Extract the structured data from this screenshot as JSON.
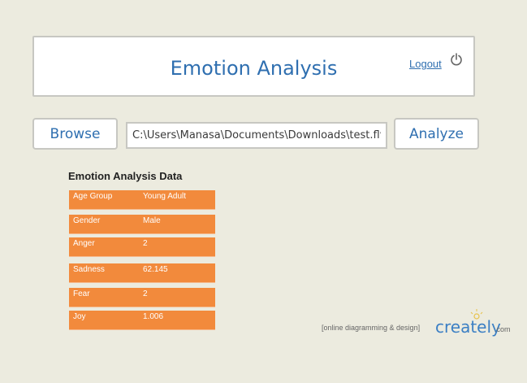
{
  "header": {
    "title": "Emotion Analysis",
    "logout_label": "Logout",
    "power_icon": "power-icon"
  },
  "toolbar": {
    "browse_label": "Browse",
    "file_path": "C:\\Users\\Manasa\\Documents\\Downloads\\test.flv",
    "analyze_label": "Analyze"
  },
  "results": {
    "title": "Emotion Analysis Data",
    "rows": [
      {
        "key": "Age Group",
        "value": "Young Adult"
      },
      {
        "key": "Gender",
        "value": "Male"
      },
      {
        "key": "Anger",
        "value": "2"
      },
      {
        "key": "Sadness",
        "value": "62.145"
      },
      {
        "key": "Fear",
        "value": "2"
      },
      {
        "key": "Joy",
        "value": "1.006"
      }
    ]
  },
  "watermark": {
    "tagline": "[online diagramming & design]",
    "logo": "creately",
    "suffix": ".com"
  },
  "colors": {
    "accent": "#2f6fb0",
    "row_bg": "#f28a3c",
    "page_bg": "#ecebdf"
  }
}
